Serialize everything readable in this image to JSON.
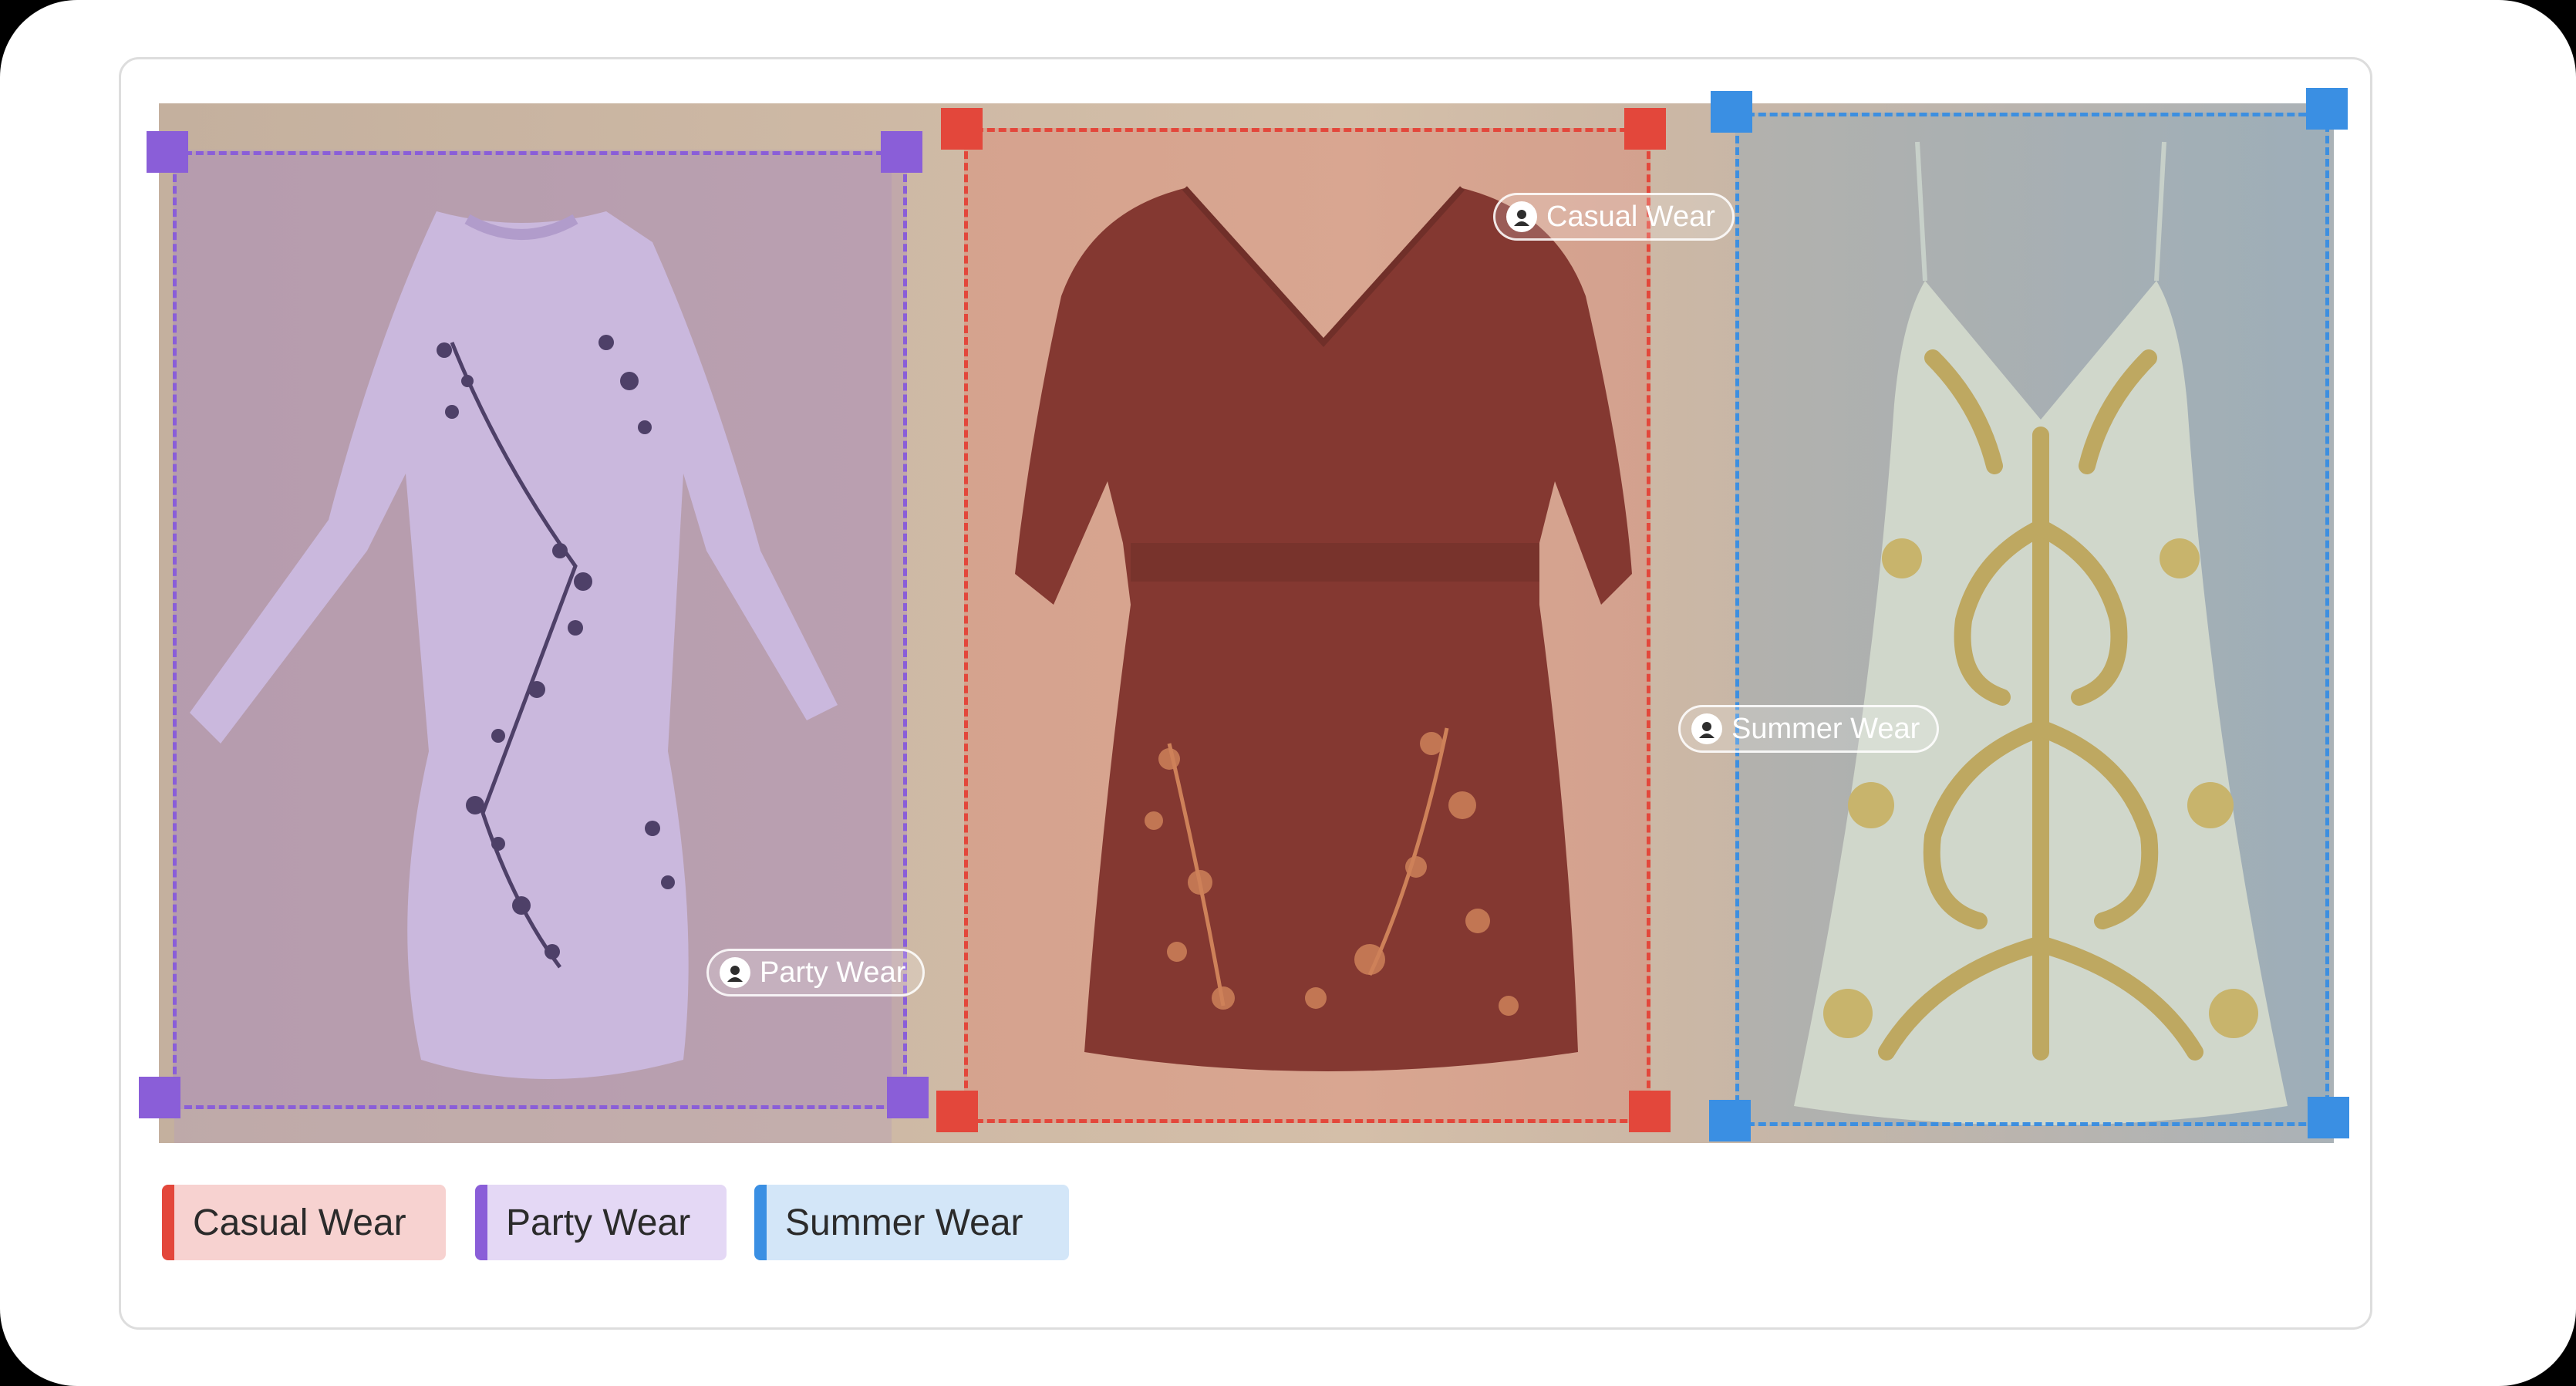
{
  "labels": {
    "party_chip": "Party Wear",
    "casual_chip": "Casual Wear",
    "summer_chip": "Summer Wear"
  },
  "legend": [
    {
      "label": "Casual Wear",
      "color": "#e3473b"
    },
    {
      "label": "Party Wear",
      "color": "#8a5ed8"
    },
    {
      "label": "Summer Wear",
      "color": "#3a8fe3"
    }
  ],
  "colors": {
    "party": "#8a5ed8",
    "casual": "#e3473b",
    "summer": "#3a8fe3"
  },
  "images": [
    {
      "name": "lavender-floral-bodycon-dress"
    },
    {
      "name": "maroon-wrap-floral-dress"
    },
    {
      "name": "gold-baroque-slip-dress"
    }
  ]
}
